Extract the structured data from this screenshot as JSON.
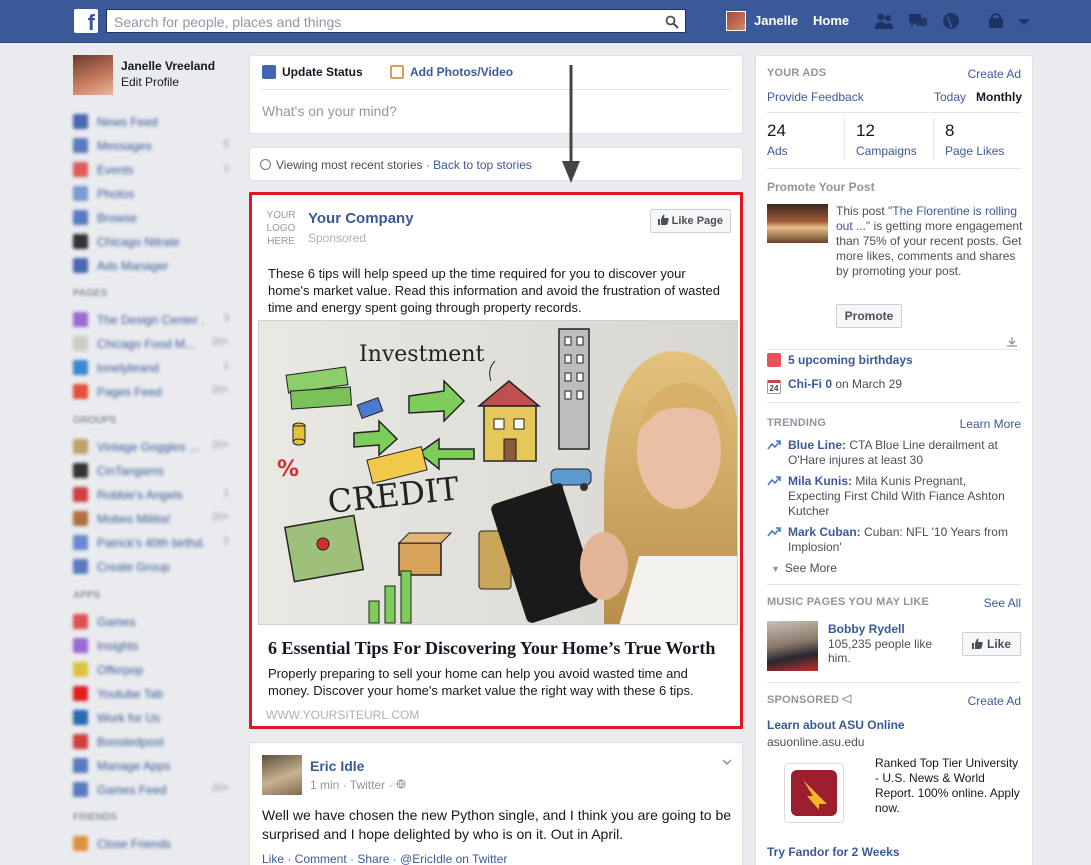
{
  "topbar": {
    "search_placeholder": "Search for people, places and things",
    "user_name": "Janelle",
    "home_label": "Home"
  },
  "left_nav": {
    "profile_name": "Janelle Vreeland",
    "edit_profile": "Edit Profile",
    "favorites": [
      {
        "label": "News Feed",
        "count": "",
        "color": "#4a69ad"
      },
      {
        "label": "Messages",
        "count": "5",
        "color": "#5b7bc0"
      },
      {
        "label": "Events",
        "count": "1",
        "color": "#e05a5a"
      },
      {
        "label": "Photos",
        "count": "",
        "color": "#7a9ad0"
      },
      {
        "label": "Browse",
        "count": "",
        "color": "#5b7bc0"
      },
      {
        "label": "Chicago Nitrate",
        "count": "",
        "color": "#333333"
      },
      {
        "label": "Ads Manager",
        "count": "",
        "color": "#4a69ad"
      }
    ],
    "pages_heading": "PAGES",
    "pages": [
      {
        "label": "The Design Center ...",
        "count": "3",
        "color": "#9a6ad0"
      },
      {
        "label": "Chicago Food M...",
        "count": "20+",
        "color": "#cccccc"
      },
      {
        "label": "lonelybrand",
        "count": "1",
        "color": "#3a88d0"
      },
      {
        "label": "Pages Feed",
        "count": "20+",
        "color": "#e0503a"
      }
    ],
    "groups_heading": "GROUPS",
    "groups": [
      {
        "label": "Vintage Goggles ...",
        "count": "20+",
        "color": "#c0a070"
      },
      {
        "label": "CinTangams",
        "count": "",
        "color": "#333333"
      },
      {
        "label": "Robbie's Angels",
        "count": "1",
        "color": "#d04040"
      },
      {
        "label": "Mobes Militia!",
        "count": "20+",
        "color": "#b07040"
      },
      {
        "label": "Patrick's 40th birthd...",
        "count": "2",
        "color": "#6a8ad0"
      },
      {
        "label": "Create Group",
        "count": "",
        "color": "#5b7bc0"
      }
    ],
    "apps_heading": "APPS",
    "apps": [
      {
        "label": "Games",
        "count": "",
        "color": "#e05050"
      },
      {
        "label": "Insights",
        "count": "",
        "color": "#9a6ad0"
      },
      {
        "label": "Offerpop",
        "count": "",
        "color": "#e0c040"
      },
      {
        "label": "Youtube Tab",
        "count": "",
        "color": "#e02020"
      },
      {
        "label": "Work for Us",
        "count": "",
        "color": "#2a6ab0"
      },
      {
        "label": "Boostedpost",
        "count": "",
        "color": "#d04040"
      },
      {
        "label": "Manage Apps",
        "count": "",
        "color": "#5b7bc0"
      },
      {
        "label": "Games Feed",
        "count": "20+",
        "color": "#5b7bc0"
      }
    ],
    "friends_heading": "FRIENDS",
    "friends": [
      {
        "label": "Close Friends",
        "count": "",
        "color": "#e09040"
      }
    ]
  },
  "composer": {
    "update_status": "Update Status",
    "add_photos": "Add Photos/Video",
    "placeholder": "What's on your mind?"
  },
  "recent": {
    "text": "Viewing most recent stories · ",
    "link": "Back to top stories"
  },
  "ad": {
    "logo_text": "YOUR LOGO HERE",
    "company": "Your Company",
    "sponsored": "Sponsored",
    "like_page": "Like Page",
    "body": "These 6 tips will help speed up the time required for you to discover your home's market value. Read this information and avoid the frustration of wasted time and energy spent going through property records.",
    "image_words": {
      "investment": "Investment",
      "credit": "CREDIT"
    },
    "headline": "6 Essential Tips For Discovering Your Home’s True Worth",
    "description": "Properly preparing to sell your home can help you avoid wasted time and money. Discover your home's market value the right way with these 6 tips.",
    "url": "WWW.YOURSITEURL.COM"
  },
  "post": {
    "author": "Eric Idle",
    "meta": "1 min · Twitter · ",
    "text": "Well we have chosen the new Python single, and I think you are going to be surprised and I hope delighted by who is on it. Out in April.",
    "actions": "Like · Comment · Share · @EricIdle on Twitter"
  },
  "right": {
    "your_ads": "YOUR ADS",
    "create_ad": "Create Ad",
    "provide_feedback": "Provide Feedback",
    "today": "Today",
    "monthly": "Monthly",
    "stats": [
      {
        "num": "24",
        "label": "Ads"
      },
      {
        "num": "12",
        "label": "Campaigns"
      },
      {
        "num": "8",
        "label": "Page Likes"
      }
    ],
    "promote_heading": "Promote Your Post",
    "promo_prefix": "This post ",
    "promo_link": "\"The Florentine is rolling out ...\"",
    "promo_suffix": " is getting more engagement than 75% of your recent posts. Get more likes, comments and shares by promoting your post.",
    "promote_btn": "Promote",
    "birthdays": "5 upcoming birthdays",
    "calendar_day": "24",
    "event_name": "Chi-Fi 0",
    "event_date": " on March 29",
    "trending_heading": "TRENDING",
    "learn_more": "Learn More",
    "trends": [
      {
        "title": "Blue Line:",
        "text": " CTA Blue Line derailment at O'Hare injures at least 30"
      },
      {
        "title": "Mila Kunis:",
        "text": " Mila Kunis Pregnant, Expecting First Child With Fiance Ashton Kutcher"
      },
      {
        "title": "Mark Cuban:",
        "text": " Cuban: NFL '10 Years from Implosion'"
      }
    ],
    "see_more": "See More",
    "music_heading": "MUSIC PAGES YOU MAY LIKE",
    "see_all": "See All",
    "music_name": "Bobby Rydell",
    "music_likes": "105,235 people like him.",
    "like_btn": "Like",
    "sponsored_heading": "SPONSORED",
    "create_ad2": "Create Ad",
    "asu_title": "Learn about ASU Online",
    "asu_url": "asuonline.asu.edu",
    "asu_text": "Ranked Top Tier University - U.S. News & World Report. 100% online. Apply now.",
    "fandor_title": "Try Fandor for 2 Weeks"
  }
}
